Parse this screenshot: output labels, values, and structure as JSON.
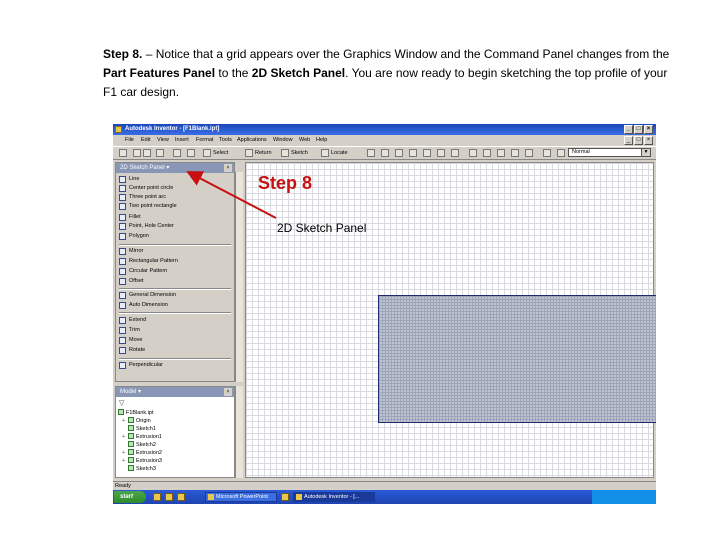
{
  "caption": {
    "p1": "Step 8. ",
    "p2": "– Notice that a grid appears over the Graphics Window and the Command Panel changes from the ",
    "p3": "Part Features Panel",
    "p4": " to the ",
    "p5": "2D Sketch Panel",
    "p6": ". You are now ready to begin sketching the top profile of your F1 car design."
  },
  "window": {
    "title": "Autodesk Inventor - [F1Blank.ipt]"
  },
  "menu": [
    "File",
    "Edit",
    "View",
    "Insert",
    "Format",
    "Tools",
    "Applications",
    "Window",
    "Web",
    "Help"
  ],
  "toolbar": {
    "select_label": "Select",
    "return_label": "Return",
    "sketch_label": "Sketch",
    "locate_label": "Locate",
    "style_value": "Normal"
  },
  "panel": {
    "title": "2D Sketch Panel",
    "tools": [
      "Line",
      "Center point circle",
      "Three point arc",
      "Two point rectangle",
      "Fillet",
      "Point, Hole Center",
      "Polygon",
      "Mirror",
      "Rectangular Pattern",
      "Circular Pattern",
      "Offset",
      "General Dimension",
      "Auto Dimension",
      "Extend",
      "Trim",
      "Move",
      "Rotate",
      "Perpendicular"
    ]
  },
  "browser": {
    "title": "Model",
    "root": "F1Blank.ipt",
    "items": [
      "Origin",
      "Sketch1",
      "Extrusion1",
      "Sketch2",
      "Extrusion2",
      "Extrusion3",
      "Sketch3"
    ]
  },
  "status": {
    "text": "Ready"
  },
  "taskbar": {
    "start_label": "start",
    "tasks": [
      "Microsoft PowerPoint",
      "Autodesk Inventor - [..."
    ]
  },
  "annotations": {
    "step_label": "Step 8",
    "panel_label": "2D Sketch Panel",
    "step_color": "#c81010"
  }
}
